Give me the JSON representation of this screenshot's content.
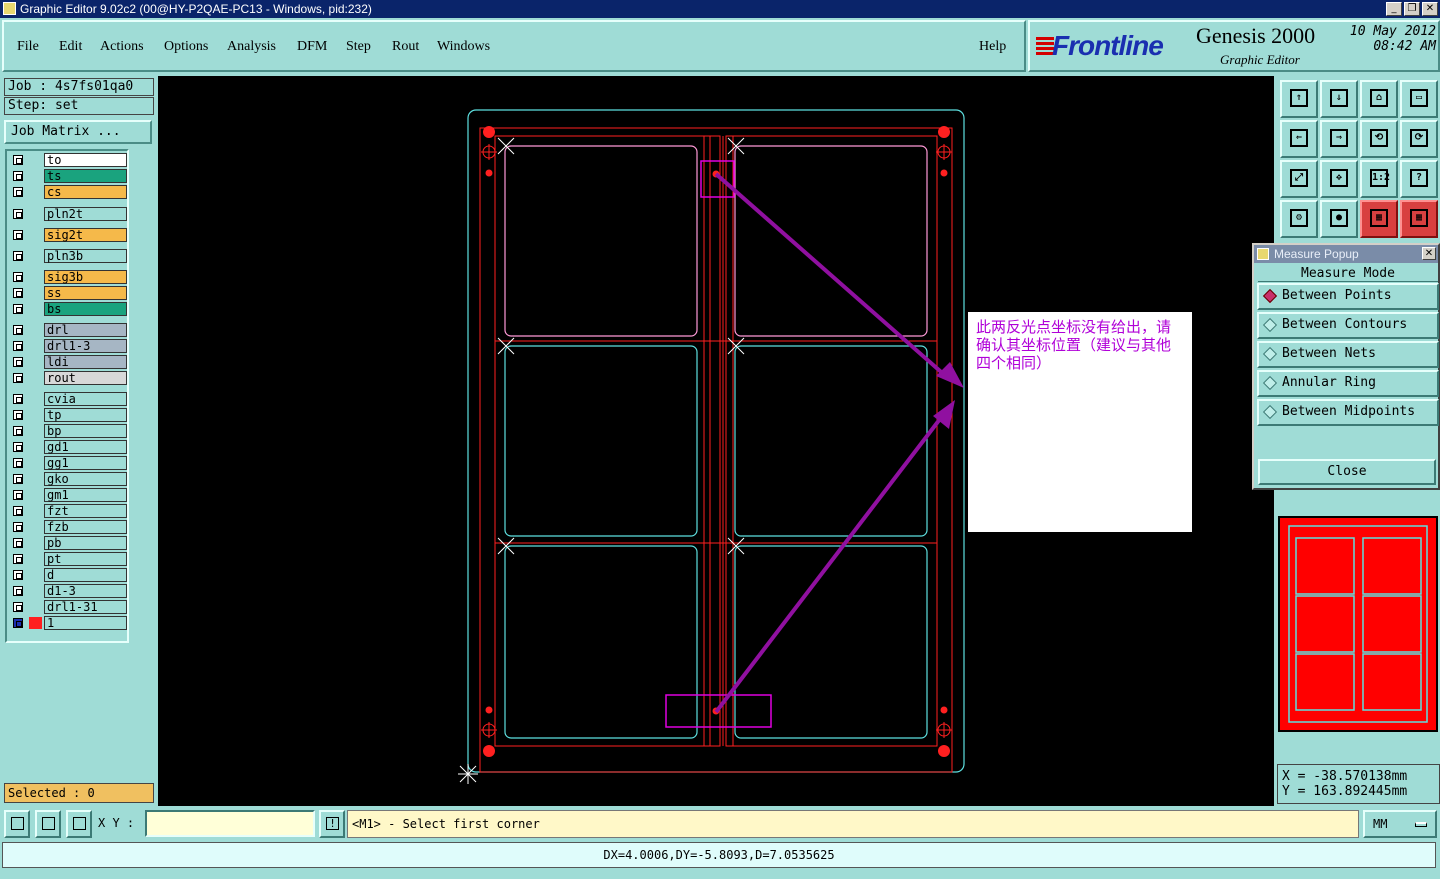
{
  "window": {
    "title": "Graphic Editor 9.02c2 (00@HY-P2QAE-PC13 - Windows, pid:232)",
    "buttons": [
      "_",
      "❐",
      "✕"
    ]
  },
  "menu": {
    "items": [
      "File",
      "Edit",
      "Actions",
      "Options",
      "Analysis",
      "DFM",
      "Step",
      "Rout",
      "Windows"
    ],
    "help": "Help"
  },
  "brand": {
    "logo": "Frontline",
    "product": "Genesis 2000",
    "subtitle": "Graphic Editor",
    "date": "10 May 2012",
    "time": "08:42 AM"
  },
  "job": {
    "job_line": "Job  : 4s7fs01qa0",
    "step_line": "Step: set",
    "matrix_button": "Job Matrix ..."
  },
  "layers": [
    {
      "name": "to",
      "color": "#ffffff"
    },
    {
      "name": "ts",
      "color": "#1aa37e"
    },
    {
      "name": "cs",
      "color": "#f5b94a"
    },
    {
      "name": "pln2t",
      "color": "#9fdcd6"
    },
    {
      "name": "sig2t",
      "color": "#f5b94a"
    },
    {
      "name": "pln3b",
      "color": "#9fdcd6"
    },
    {
      "name": "sig3b",
      "color": "#f5b94a"
    },
    {
      "name": "ss",
      "color": "#f5b94a"
    },
    {
      "name": "bs",
      "color": "#1aa37e"
    },
    {
      "name": "drl",
      "color": "#a6b6c4"
    },
    {
      "name": "drl1-3",
      "color": "#a6b6c4"
    },
    {
      "name": "ldi",
      "color": "#a6b6c4"
    },
    {
      "name": "rout",
      "color": "#d8d8d8"
    },
    {
      "name": "cvia",
      "color": "#9fdcd6"
    },
    {
      "name": "tp",
      "color": "#9fdcd6"
    },
    {
      "name": "bp",
      "color": "#9fdcd6"
    },
    {
      "name": "gd1",
      "color": "#9fdcd6"
    },
    {
      "name": "gg1",
      "color": "#9fdcd6"
    },
    {
      "name": "gko",
      "color": "#9fdcd6"
    },
    {
      "name": "gm1",
      "color": "#9fdcd6"
    },
    {
      "name": "fzt",
      "color": "#9fdcd6"
    },
    {
      "name": "fzb",
      "color": "#9fdcd6"
    },
    {
      "name": "pb",
      "color": "#9fdcd6"
    },
    {
      "name": "pt",
      "color": "#9fdcd6"
    },
    {
      "name": "d",
      "color": "#9fdcd6"
    },
    {
      "name": "d1-3",
      "color": "#9fdcd6"
    },
    {
      "name": "drl1-31",
      "color": "#9fdcd6"
    },
    {
      "name": "1",
      "color": "#9fdcd6"
    }
  ],
  "selected_text": "Selected : 0",
  "annotation": "此两反光点坐标没有给出，请确认其坐标位置（建议与其他四个相同）",
  "colors": {
    "canvas_bg": "#000000",
    "outline_cyan": "#5ee0e0",
    "route_red": "#ff2020",
    "annotation_magenta": "#c000e0",
    "panel_bg": "#9fdcd6"
  },
  "measure_popup": {
    "title": "Measure Popup",
    "header": "Measure Mode",
    "modes": [
      "Between Points",
      "Between Contours",
      "Between Nets",
      "Annular Ring",
      "Between Midpoints"
    ],
    "active_mode": "Between Points",
    "close_label": "Close"
  },
  "cursor": {
    "x_line": "X  =  -38.570138mm",
    "y_line": "Y  =  163.892445mm"
  },
  "command": {
    "xy_label": "X Y :",
    "xy_value": "",
    "prompt": "<M1> - Select first corner",
    "units": "MM"
  },
  "status_text": "DX=4.0006,DY=-5.8093,D=7.0535625",
  "tool_icons": [
    "pan-up-icon",
    "pan-down-icon",
    "home-icon",
    "window-icon",
    "pan-left-icon",
    "pan-right-icon",
    "zoom-back-icon",
    "redraw-icon",
    "zoom-fit-icon",
    "zoom-center-icon",
    "scale-1-2-icon",
    "help-icon",
    "tools-icon",
    "snap-icon",
    "layers-red-icon",
    "layers-blue-icon"
  ]
}
